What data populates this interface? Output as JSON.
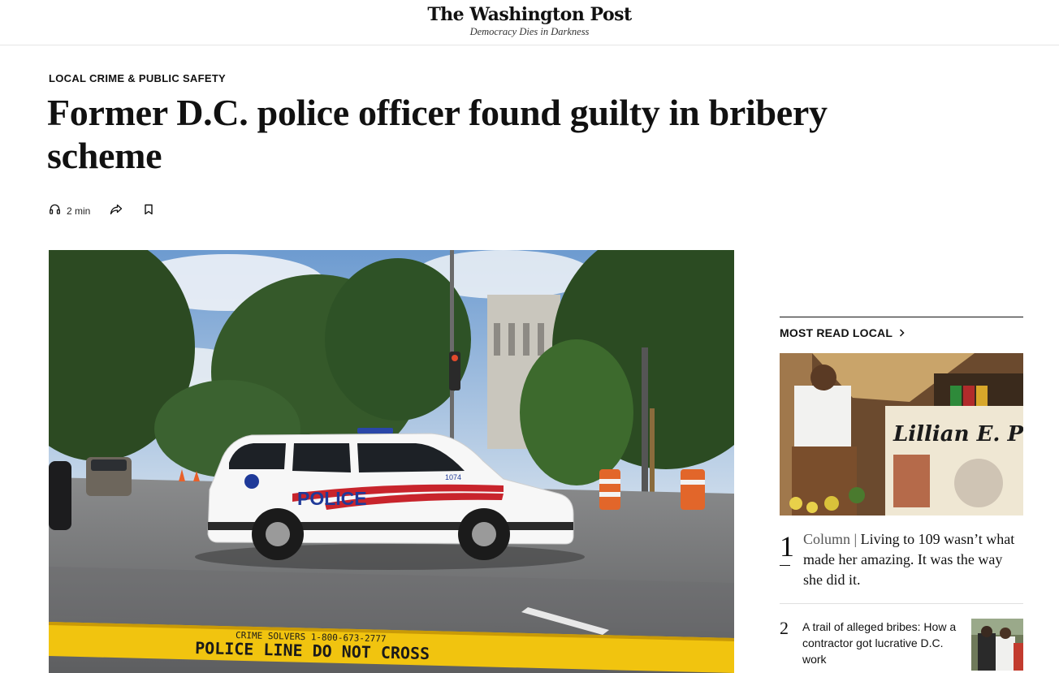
{
  "masthead": {
    "logo": "The Washington Post",
    "tagline": "Democracy Dies in Darkness"
  },
  "article": {
    "kicker": "LOCAL CRIME & PUBLIC SAFETY",
    "headline": "Former D.C. police officer found guilty in bribery scheme",
    "listen_label": "2 min"
  },
  "photo": {
    "car_text": "POLICE",
    "unit_number": "1074",
    "tape_text": "POLICE LINE DO NOT CROSS",
    "tape_text2": "CRIME SOLVERS 1-800-673-2777"
  },
  "most_read": {
    "heading": "MOST READ LOCAL",
    "image_sign": "Lillian E. Ph",
    "items": [
      {
        "rank": "1",
        "label": "Column",
        "separator": "|",
        "title": "Living to 109 wasn’t what made her amazing. It was the way she did it."
      },
      {
        "rank": "2",
        "title": "A trail of alleged bribes: How a contractor got lucrative D.C. work"
      }
    ]
  },
  "icons": [
    "headphones-icon",
    "share-icon",
    "bookmark-icon",
    "chevron-right-icon"
  ]
}
